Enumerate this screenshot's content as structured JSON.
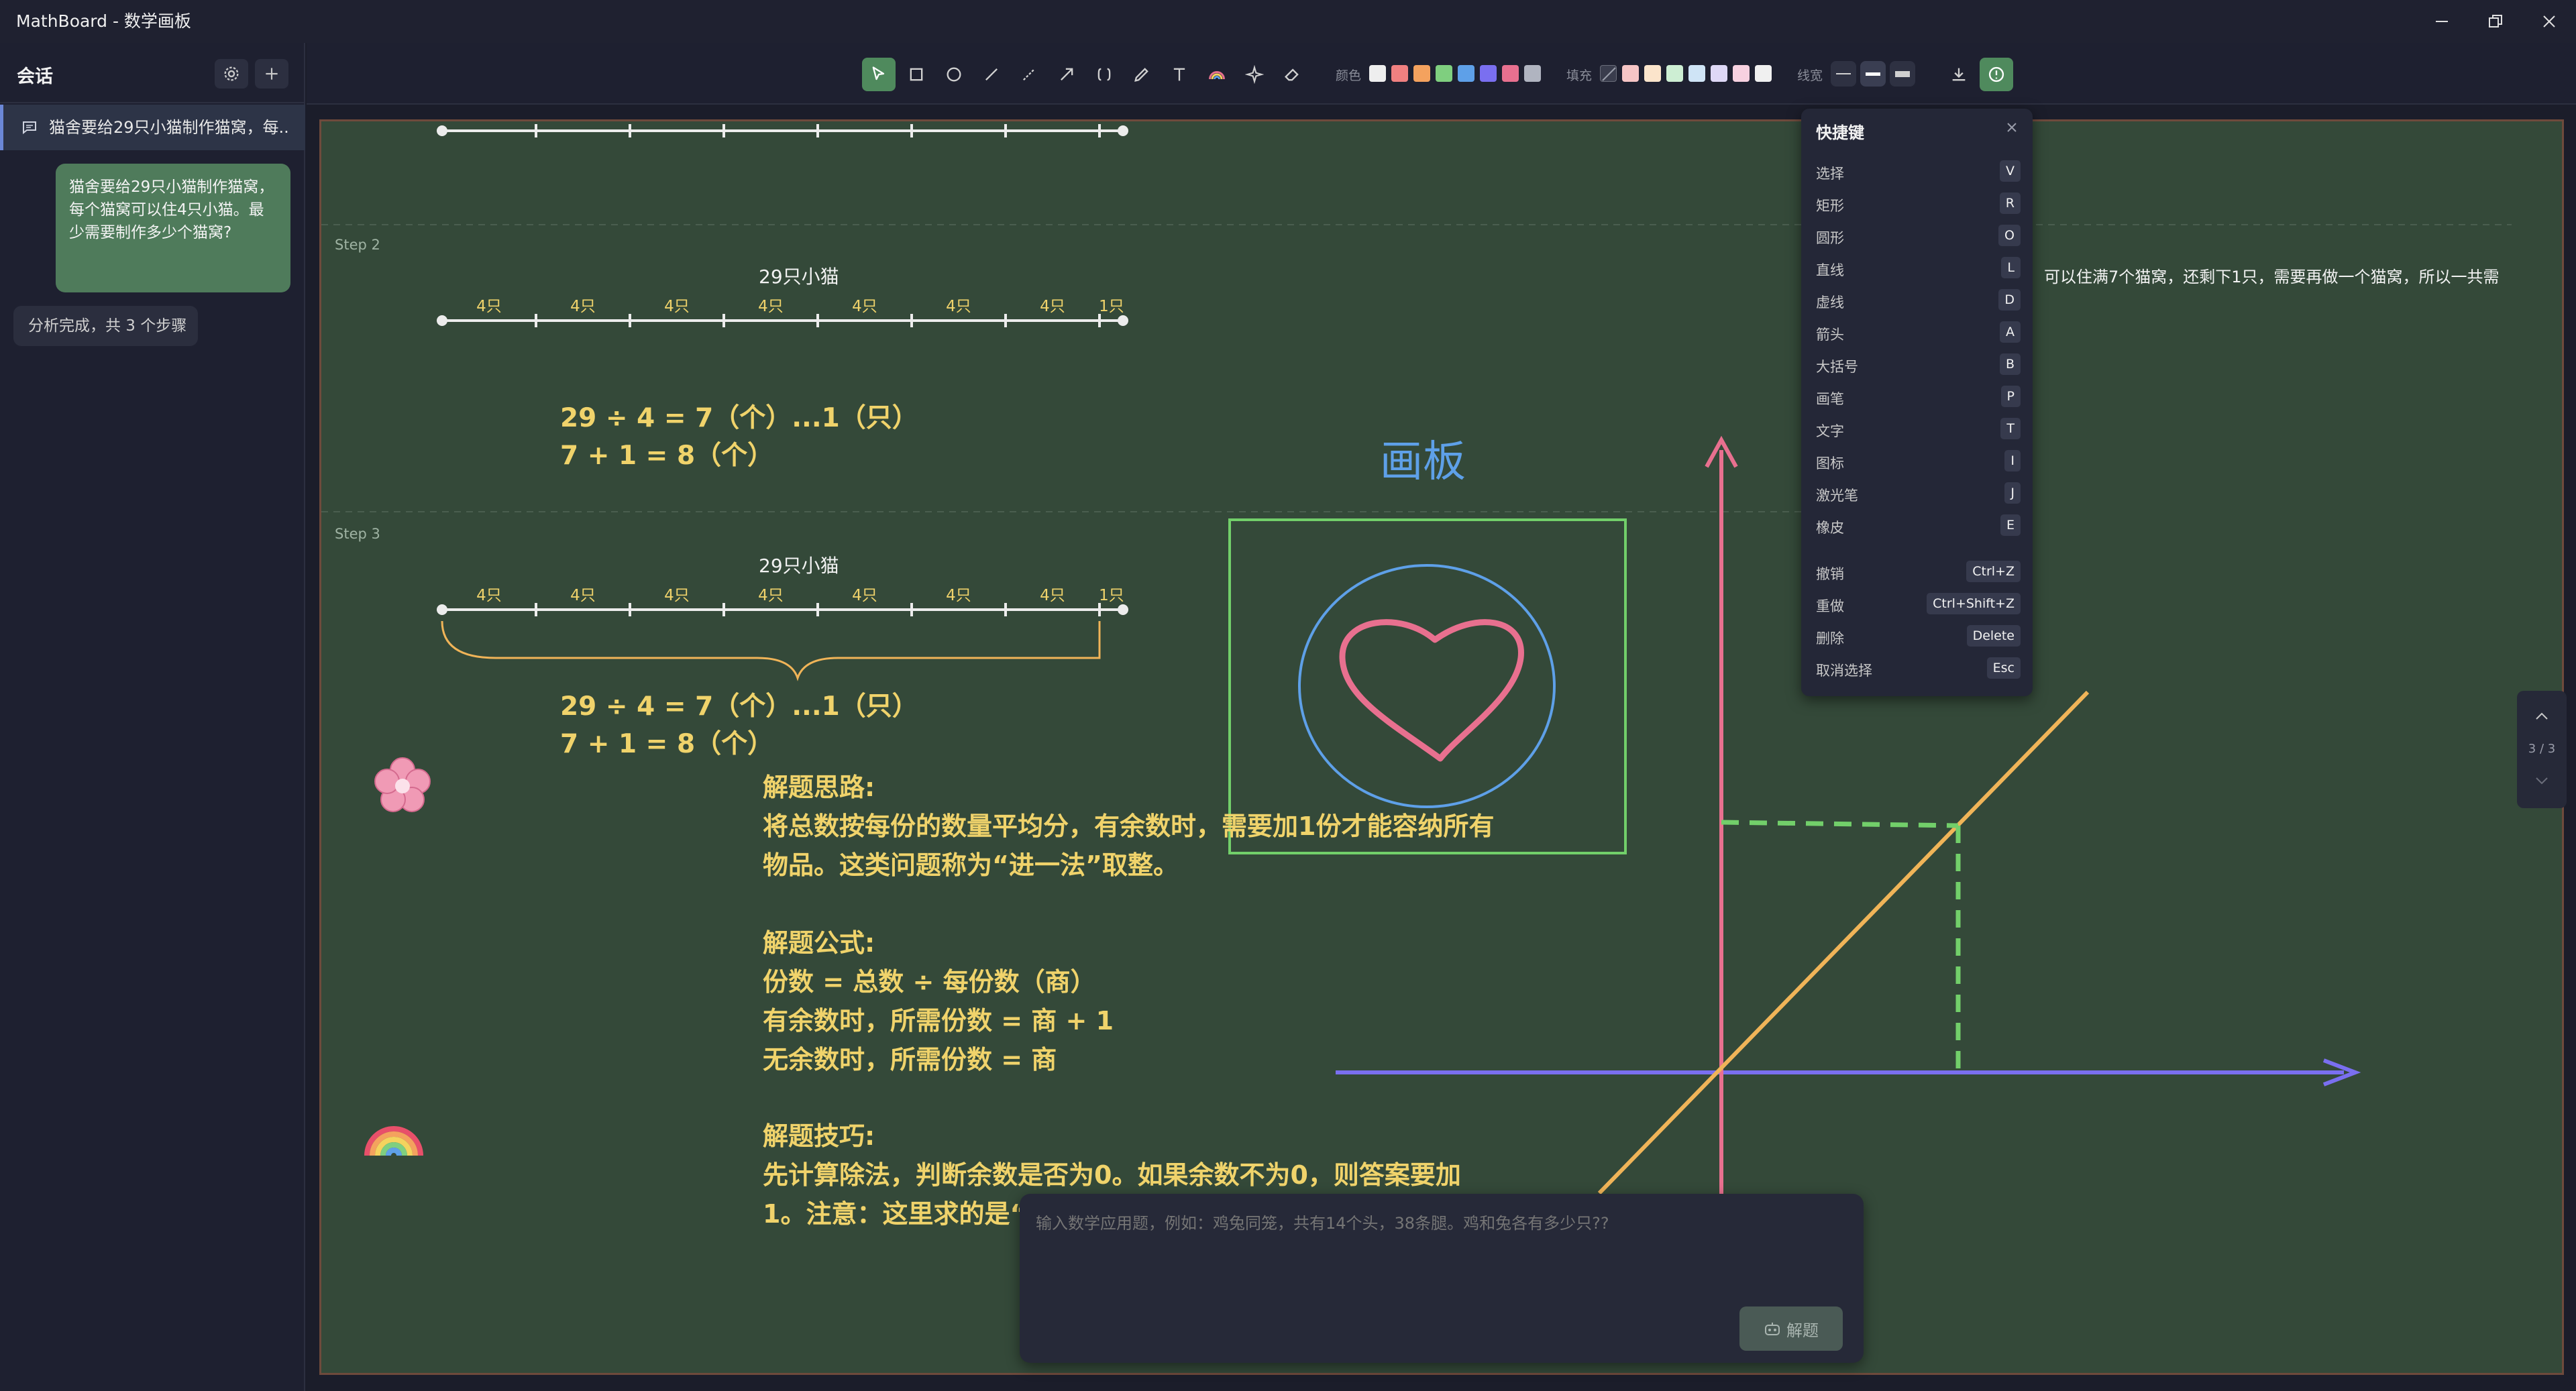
{
  "window": {
    "title": "MathBoard - 数学画板"
  },
  "sidebar": {
    "title": "会话",
    "session_title": "猫舍要给29只小猫制作猫窝，每...",
    "user_message": "猫舍要给29只小猫制作猫窝，每个猫窝可以住4只小猫。最少需要制作多少个猫窝?",
    "system_message": "分析完成，共 3 个步骤"
  },
  "toolbar": {
    "color_label": "颜色",
    "fill_label": "填充",
    "stroke_label": "线宽",
    "colors": [
      "#eeeeee",
      "#f08080",
      "#f4a25e",
      "#7fcf7f",
      "#5ea0e8",
      "#7a6ff0",
      "#e8708f",
      "#b0b4c0"
    ],
    "fills": [
      "#f6c5c5",
      "#fbe4cb",
      "#cdeed3",
      "#cfe4f6",
      "#ded8f6",
      "#f7d1e0",
      "#f0f0f0"
    ]
  },
  "canvas": {
    "step2_label": "Step 2",
    "step3_label": "Step 3",
    "caption": "29只小猫",
    "segments": [
      "4只",
      "4只",
      "4只",
      "4只",
      "4只",
      "4只",
      "4只",
      "1只"
    ],
    "eq1": "29 ÷ 4 = 7（个）...1（只）",
    "eq2": "7 + 1 = 8（个）",
    "board_title": "画板",
    "side_text": "可以住满7个猫窝，还剩下1只，需要再做一个猫窝，所以一共需",
    "thinking_title": "解题思路:",
    "thinking_body": "将总数按每份的数量平均分，有余数时，需要加1份才能容纳所有物品。这类问题称为“进一法”取整。",
    "formula_title": "解题公式:",
    "formula_1": "份数 = 总数 ÷ 每份数（商）",
    "formula_2": "有余数时，所需份数 = 商 + 1",
    "formula_3": "无余数时，所需份数 = 商",
    "tips_title": "解题技巧:",
    "tips_body": "先计算除法，判断余数是否为0。如果余数不为0，则答案要加1。注意：这里求的是“最少需要”，不能直接舍去"
  },
  "shortcuts": {
    "title": "快捷键",
    "items": [
      {
        "label": "选择",
        "key": "V"
      },
      {
        "label": "矩形",
        "key": "R"
      },
      {
        "label": "圆形",
        "key": "O"
      },
      {
        "label": "直线",
        "key": "L"
      },
      {
        "label": "虚线",
        "key": "D"
      },
      {
        "label": "箭头",
        "key": "A"
      },
      {
        "label": "大括号",
        "key": "B"
      },
      {
        "label": "画笔",
        "key": "P"
      },
      {
        "label": "文字",
        "key": "T"
      },
      {
        "label": "图标",
        "key": "I"
      },
      {
        "label": "激光笔",
        "key": "J"
      },
      {
        "label": "橡皮",
        "key": "E"
      },
      {
        "label": "撤销",
        "key": "Ctrl+Z"
      },
      {
        "label": "重做",
        "key": "Ctrl+Shift+Z"
      },
      {
        "label": "删除",
        "key": "Delete"
      },
      {
        "label": "取消选择",
        "key": "Esc"
      }
    ]
  },
  "input": {
    "placeholder": "输入数学应用题，例如：鸡兔同笼，共有14个头，38条腿。鸡和兔各有多少只??",
    "solve_label": "解题"
  },
  "pager": {
    "text": "3 / 3"
  }
}
